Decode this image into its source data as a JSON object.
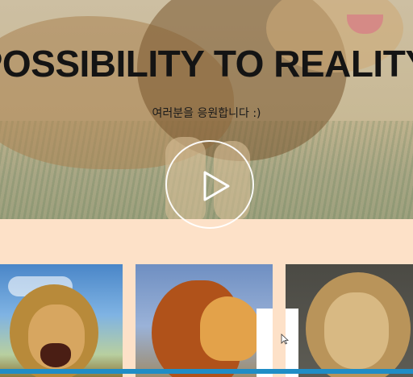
{
  "hero": {
    "title": "POSSIBILITY TO REALITY!",
    "subtitle": "여러분을 응원합니다 :)",
    "play_icon": "play-icon"
  },
  "cards": [
    {
      "name": "lion-roaring"
    },
    {
      "name": "lion-profile"
    },
    {
      "name": "lion-portrait"
    }
  ],
  "colors": {
    "band": "#fde1c8",
    "progress": "#3aa5d8"
  },
  "video": {
    "progress": 1.0
  }
}
